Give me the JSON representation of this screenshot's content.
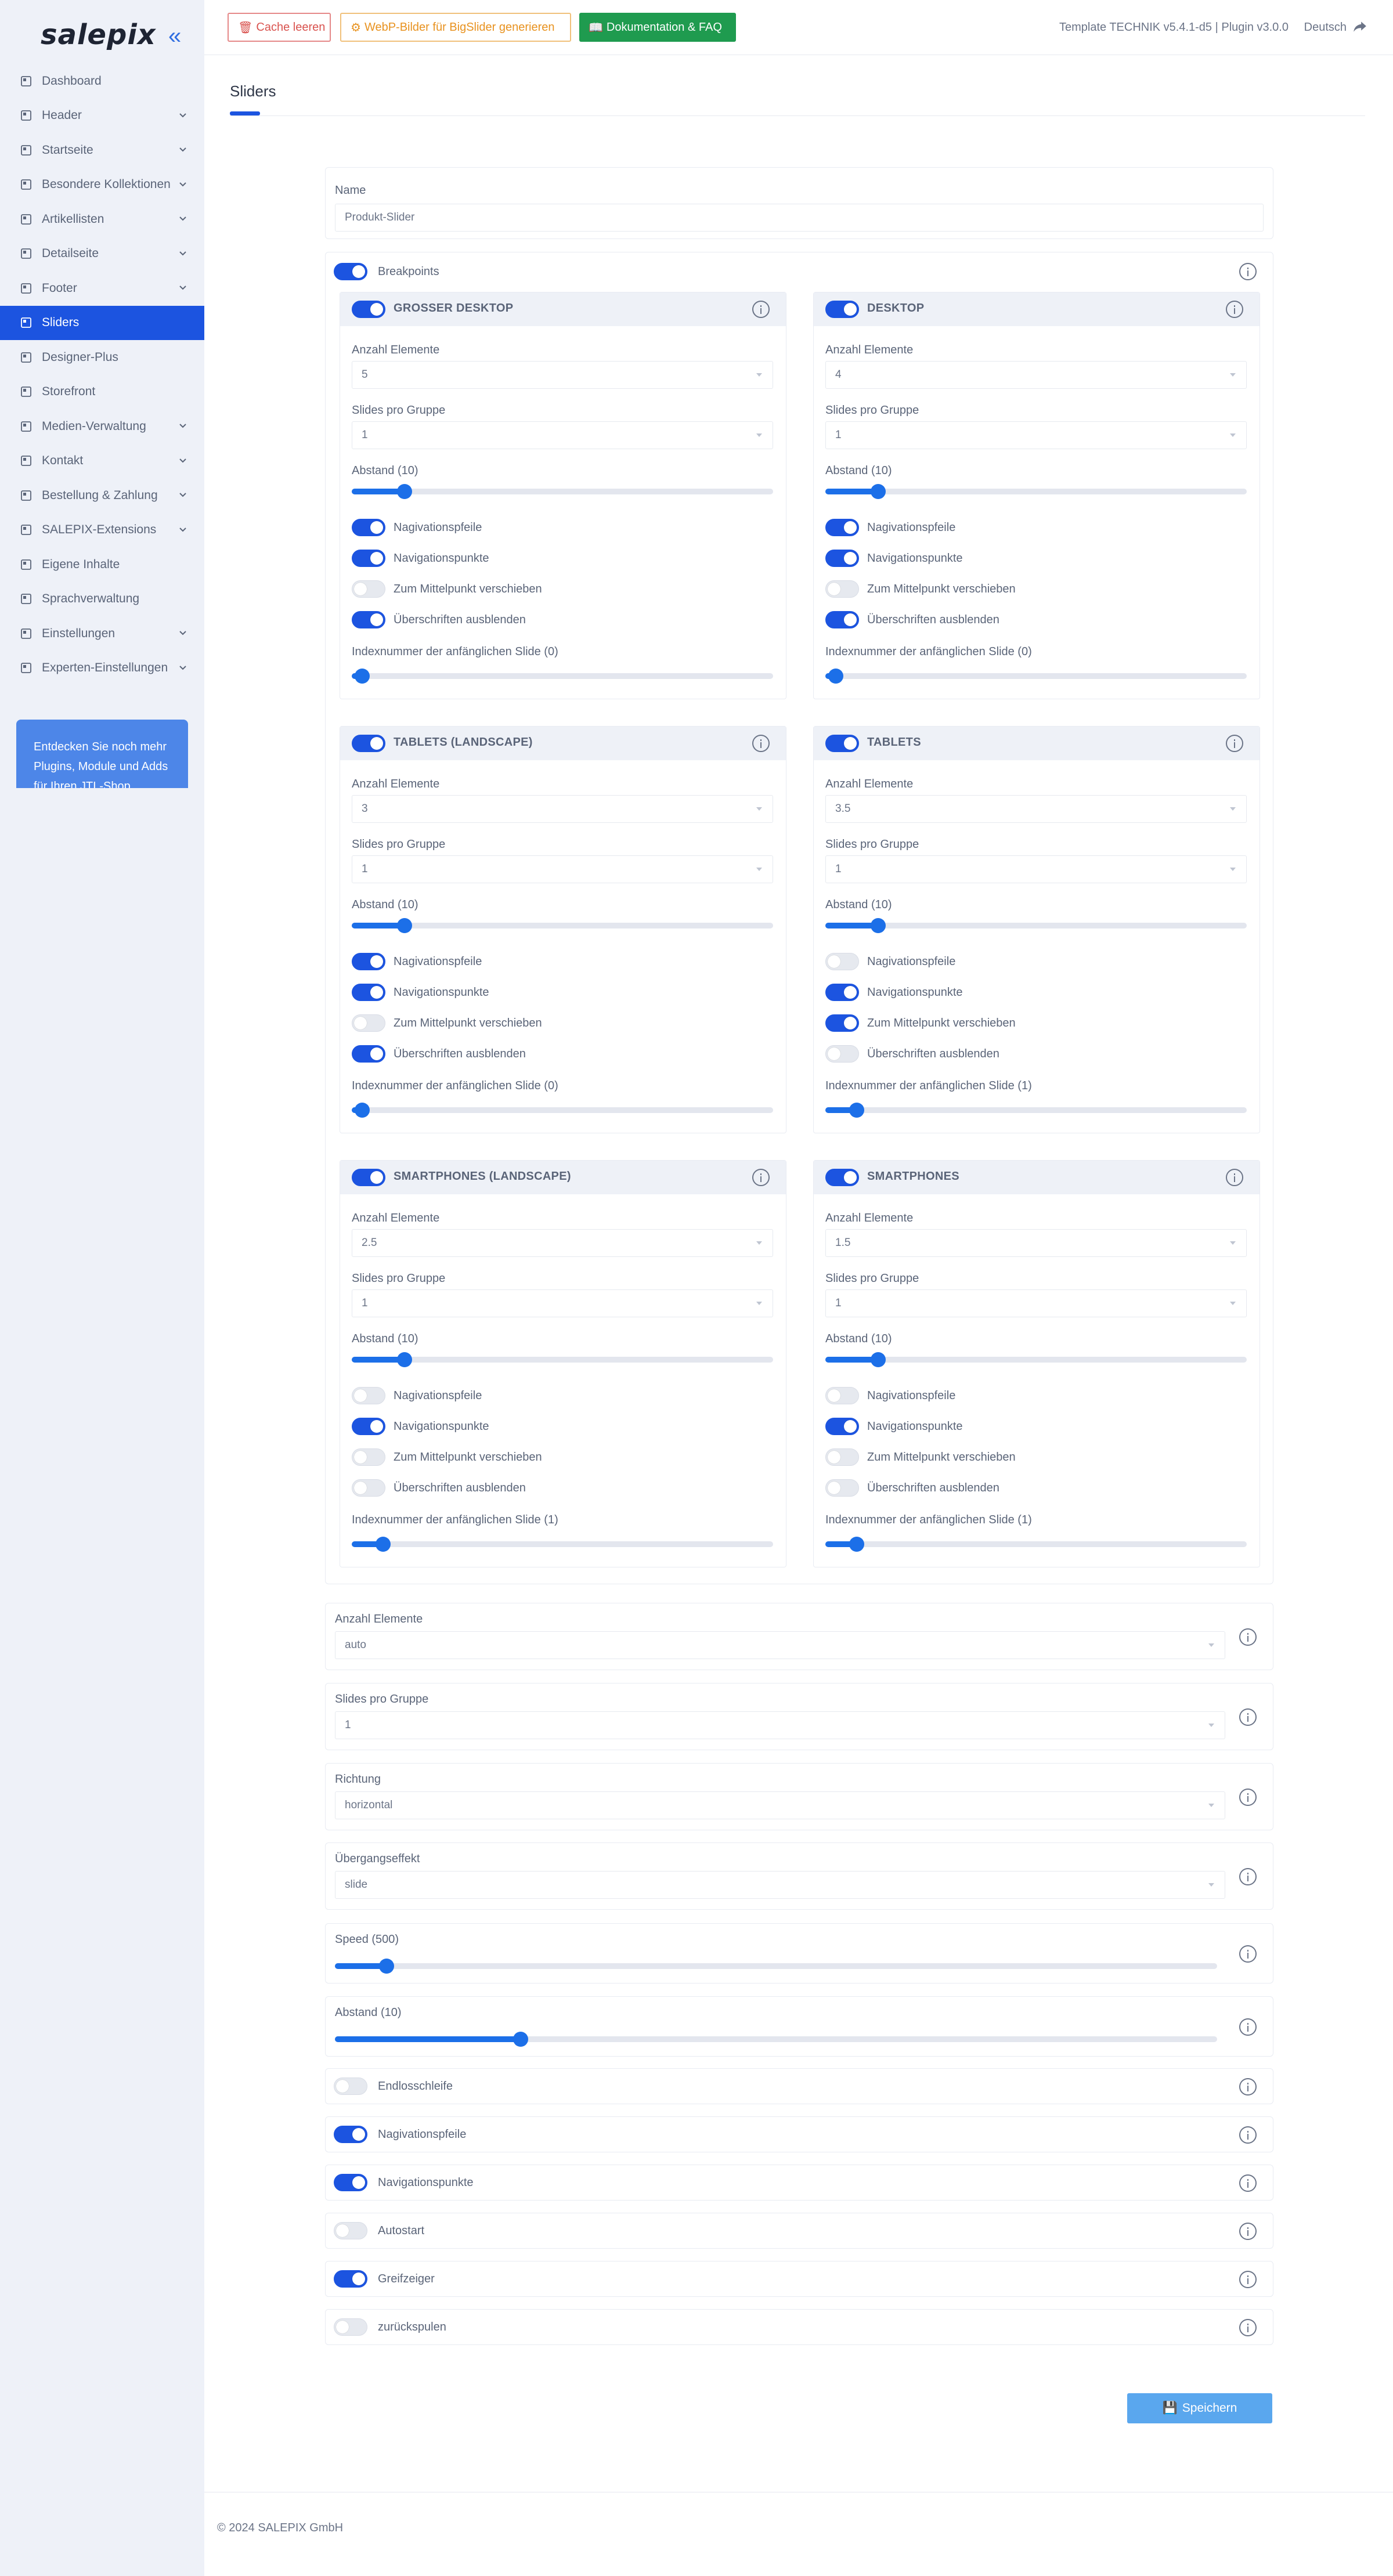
{
  "sidebar": {
    "logo": "salepix",
    "items": [
      {
        "label": "Dashboard",
        "icon": "dashboard-icon",
        "chevron": false
      },
      {
        "label": "Header",
        "icon": "header-icon",
        "chevron": true
      },
      {
        "label": "Startseite",
        "icon": "home-icon",
        "chevron": true
      },
      {
        "label": "Besondere Kollektionen",
        "icon": "collection-icon",
        "chevron": true
      },
      {
        "label": "Artikellisten",
        "icon": "list-icon",
        "chevron": true
      },
      {
        "label": "Detailseite",
        "icon": "detail-icon",
        "chevron": true
      },
      {
        "label": "Footer",
        "icon": "footer-icon",
        "chevron": true
      },
      {
        "label": "Sliders",
        "icon": "slider-icon",
        "chevron": false,
        "active": true
      },
      {
        "label": "Designer-Plus",
        "icon": "designer-icon",
        "chevron": false
      },
      {
        "label": "Storefront",
        "icon": "storefront-icon",
        "chevron": false
      },
      {
        "label": "Medien-Verwaltung",
        "icon": "media-icon",
        "chevron": true
      },
      {
        "label": "Kontakt",
        "icon": "contact-icon",
        "chevron": true
      },
      {
        "label": "Bestellung & Zahlung",
        "icon": "order-icon",
        "chevron": true
      },
      {
        "label": "SALEPIX-Extensions",
        "icon": "extensions-icon",
        "chevron": true
      },
      {
        "label": "Eigene Inhalte",
        "icon": "content-icon",
        "chevron": false
      },
      {
        "label": "Sprachverwaltung",
        "icon": "language-icon",
        "chevron": false
      },
      {
        "label": "Einstellungen",
        "icon": "settings-icon",
        "chevron": true
      },
      {
        "label": "Experten-Einstellungen",
        "icon": "gear-icon",
        "chevron": true
      }
    ],
    "promo": "Entdecken Sie noch mehr Plugins, Module und Adds für Ihren JTL-Shop"
  },
  "topbar": {
    "cache_label": "Cache leeren",
    "webp_label": "WebP-Bilder für BigSlider generieren",
    "doc_label": "Dokumentation & FAQ",
    "version": "Template TECHNIK v5.4.1-d5 | Plugin v3.0.0",
    "language": "Deutsch"
  },
  "page": {
    "title": "Sliders"
  },
  "form": {
    "name_label": "Name",
    "name_value": "Produkt-Slider",
    "breakpoints_label": "Breakpoints",
    "breakpoints_on": true,
    "labels": {
      "count": "Anzahl Elemente",
      "per_group": "Slides pro Gruppe",
      "gap": "Abstand (10)",
      "arrows": "Nagivationspfeile",
      "dots": "Navigationspunkte",
      "center": "Zum Mittelpunkt verschieben",
      "hide_headings": "Überschriften ausblenden"
    },
    "breakpoints": [
      {
        "title": "GROSSER DESKTOP",
        "count": "5",
        "per_group": "1",
        "gap": 10,
        "arrows": true,
        "dots": true,
        "center": false,
        "hide": true,
        "index_label": "Indexnummer der anfänglichen Slide (0)",
        "index": 0
      },
      {
        "title": "DESKTOP",
        "count": "4",
        "per_group": "1",
        "gap": 10,
        "arrows": true,
        "dots": true,
        "center": false,
        "hide": true,
        "index_label": "Indexnummer der anfänglichen Slide (0)",
        "index": 0
      },
      {
        "title": "TABLETS (LANDSCAPE)",
        "count": "3",
        "per_group": "1",
        "gap": 10,
        "arrows": true,
        "dots": true,
        "center": false,
        "hide": true,
        "index_label": "Indexnummer der anfänglichen Slide (0)",
        "index": 0
      },
      {
        "title": "TABLETS",
        "count": "3.5",
        "per_group": "1",
        "gap": 10,
        "arrows": false,
        "dots": true,
        "center": true,
        "hide": false,
        "index_label": "Indexnummer der anfänglichen Slide (1)",
        "index": 1
      },
      {
        "title": "SMARTPHONES (LANDSCAPE)",
        "count": "2.5",
        "per_group": "1",
        "gap": 10,
        "arrows": false,
        "dots": true,
        "center": false,
        "hide": false,
        "index_label": "Indexnummer der anfänglichen Slide (1)",
        "index": 1
      },
      {
        "title": "SMARTPHONES",
        "count": "1.5",
        "per_group": "1",
        "gap": 10,
        "arrows": false,
        "dots": true,
        "center": false,
        "hide": false,
        "index_label": "Indexnummer der anfänglichen Slide (1)",
        "index": 1
      }
    ],
    "global": {
      "count_label": "Anzahl Elemente",
      "count_value": "auto",
      "per_group_label": "Slides pro Gruppe",
      "per_group_value": "1",
      "direction_label": "Richtung",
      "direction_value": "horizontal",
      "effect_label": "Übergangseffekt",
      "effect_value": "slide",
      "speed_label": "Speed (500)",
      "speed_value": 500,
      "gap_label": "Abstand (10)",
      "gap_value": 10
    },
    "toggles": [
      {
        "label": "Endlosschleife",
        "on": false
      },
      {
        "label": "Nagivationspfeile",
        "on": true
      },
      {
        "label": "Navigationspunkte",
        "on": true
      },
      {
        "label": "Autostart",
        "on": false
      },
      {
        "label": "Greifzeiger",
        "on": true
      },
      {
        "label": "zurückspulen",
        "on": false
      }
    ],
    "save_label": "Speichern"
  },
  "footer": {
    "copyright": "© 2024 SALEPIX GmbH"
  },
  "colors": {
    "accent": "#1c54e0",
    "slider": "#1c6fe8",
    "success": "#1f9b4f",
    "danger": "#d9534f",
    "warning": "#e8921f"
  }
}
